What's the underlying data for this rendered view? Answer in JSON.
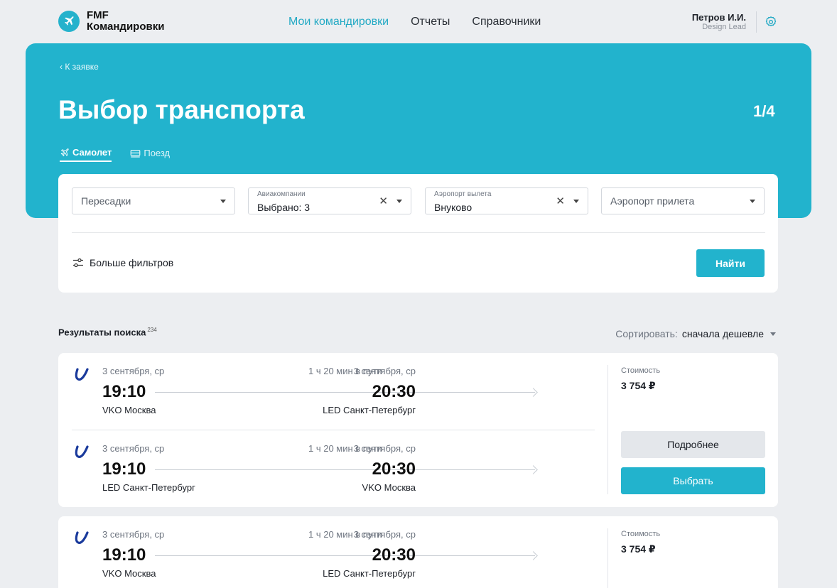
{
  "app": {
    "logo_line1": "FMF",
    "logo_line2": "Командировки"
  },
  "nav": {
    "items": [
      {
        "label": "Мои командировки",
        "active": true
      },
      {
        "label": "Отчеты",
        "active": false
      },
      {
        "label": "Справочники",
        "active": false
      }
    ]
  },
  "user": {
    "name": "Петров И.И.",
    "role": "Design Lead"
  },
  "hero": {
    "back_label": "К заявке",
    "title": "Выбор транспорта",
    "step": "1/4",
    "tabs": [
      {
        "label": "Самолет",
        "active": true,
        "icon": "plane-icon"
      },
      {
        "label": "Поезд",
        "active": false,
        "icon": "train-icon"
      }
    ]
  },
  "filters": {
    "transfers": {
      "placeholder": "Пересадки"
    },
    "airlines": {
      "label": "Авиакомпании",
      "value": "Выбрано: 3"
    },
    "departure": {
      "label": "Аэропорт вылета",
      "value": "Внуково"
    },
    "arrival": {
      "placeholder": "Аэропорт прилета"
    },
    "more_filters_label": "Больше фильтров",
    "find_label": "Найти"
  },
  "results": {
    "title": "Результаты поиска",
    "count": "234",
    "sort_label": "Сортировать:",
    "sort_value": "сначала дешевле"
  },
  "cards": [
    {
      "price_label": "Стоимость",
      "price": "3 754 ₽",
      "details_label": "Подробнее",
      "select_label": "Выбрать",
      "segments": [
        {
          "dep_date": "3 сентября, ср",
          "duration": "1 ч 20 мин в пути",
          "arr_date": "3 сентября, ср",
          "dep_time": "19:10",
          "arr_time": "20:30",
          "dep_city": "VKO Москва",
          "arr_city": "LED Санкт-Петербург"
        },
        {
          "dep_date": "3 сентября, ср",
          "duration": "1 ч 20 мин в пути",
          "arr_date": "3 сентября, ср",
          "dep_time": "19:10",
          "arr_time": "20:30",
          "dep_city": "LED Санкт-Петербург",
          "arr_city": "VKO Москва"
        }
      ]
    },
    {
      "price_label": "Стоимость",
      "price": "3 754 ₽",
      "segments": [
        {
          "dep_date": "3 сентября, ср",
          "duration": "1 ч 20 мин в пути",
          "arr_date": "3 сентября, ср",
          "dep_time": "19:10",
          "arr_time": "20:30",
          "dep_city": "VKO Москва",
          "arr_city": "LED Санкт-Петербург"
        }
      ]
    }
  ],
  "colors": {
    "accent": "#22b3cd",
    "background": "#eceef1",
    "airline_logo": "#1a3a9c"
  }
}
